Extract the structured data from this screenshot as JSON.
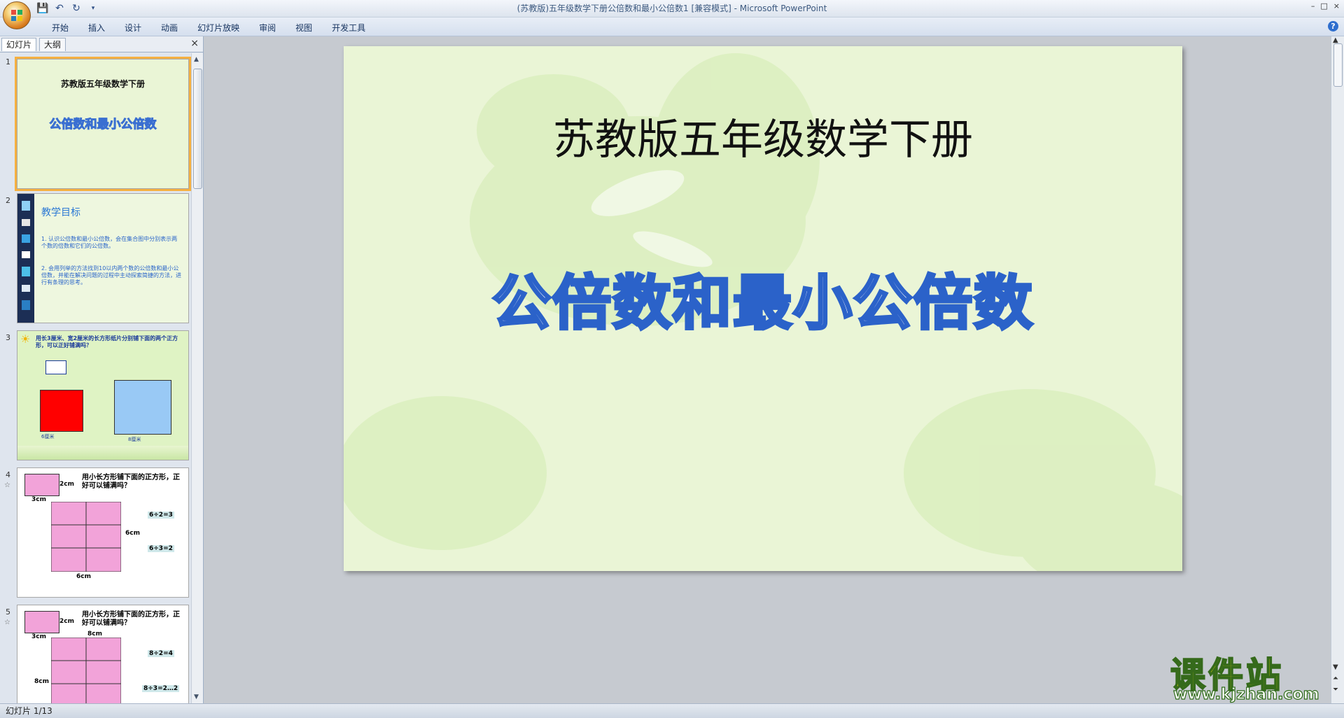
{
  "window": {
    "title": "(苏教版)五年级数学下册公倍数和最小公倍数1 [兼容模式] - Microsoft PowerPoint",
    "controls": [
      "–",
      "□",
      "×"
    ]
  },
  "ribbon": {
    "tabs": [
      "开始",
      "插入",
      "设计",
      "动画",
      "幻灯片放映",
      "审阅",
      "视图",
      "开发工具"
    ]
  },
  "left_pane": {
    "tabs": [
      "幻灯片",
      "大纲"
    ],
    "close": "×",
    "thumbnails": [
      {
        "number": "1",
        "title": "苏教版五年级数学下册",
        "subtitle": "公倍数和最小公倍数"
      },
      {
        "number": "2",
        "title": "教学目标",
        "bullets": [
          "1. 认识公倍数和最小公倍数，会在集合图中分别表示两个数的倍数和它们的公倍数。",
          "2. 会用列举的方法找到10以内两个数的公倍数和最小公倍数，并能在解决问题的过程中主动探索简捷的方法，进行有条理的思考。"
        ]
      },
      {
        "number": "3",
        "text": "用长3厘米、宽2厘米的长方形纸片分别铺下面的两个正方形，可以正好铺满吗？",
        "label_a": "6厘米",
        "label_b": "8厘米"
      },
      {
        "number": "4",
        "text": "用小长方形铺下面的正方形，正好可以铺满吗？",
        "w": "2cm",
        "h": "3cm",
        "side": "6cm",
        "eq1": "6÷2=3",
        "eq2": "6÷3=2"
      },
      {
        "number": "5",
        "text": "用小长方形铺下面的正方形，正好可以铺满吗？",
        "w": "2cm",
        "h": "3cm",
        "side": "8cm",
        "eq1": "8÷2=4",
        "eq2": "8÷3=2…2"
      }
    ]
  },
  "slide": {
    "title": "苏教版五年级数学下册",
    "subtitle": "公倍数和最小公倍数"
  },
  "status": {
    "text": "幻灯片 1/13"
  },
  "watermark": {
    "brand": "课件站",
    "url": "www.kjzhan.com"
  },
  "colors": {
    "slide_bg": "#eaf5d6",
    "subtitle_stroke": "#2b62c9",
    "selected_outline": "#f5b041"
  }
}
